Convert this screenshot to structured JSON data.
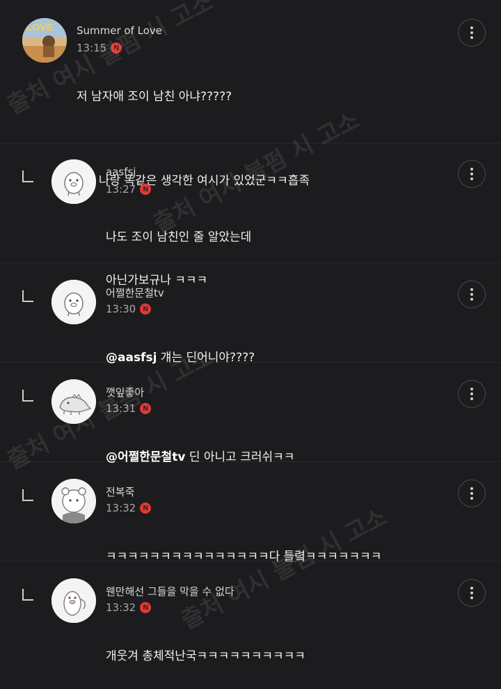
{
  "badge_letter": "N",
  "comments": [
    {
      "name": "Summer of Love",
      "time": "13:15",
      "lines": [
        "저 남자애 조이 남친 아냐?????",
        "",
        "아.. 나랑 똑같은 생각한 여시가 있었군ㅋㅋ흡족"
      ],
      "reply": false
    },
    {
      "name": "aasfsj",
      "time": "13:27",
      "lines": [
        "나도 조이 남친인 줄 알았는데",
        "아닌가보규나 ㅋㅋㅋ"
      ],
      "reply": true
    },
    {
      "name": "어쩔한문철tv",
      "time": "13:30",
      "mention": "@aasfsj",
      "text": " 걔는 딘어니야????",
      "reply": true
    },
    {
      "name": "깻잎좋아",
      "time": "13:31",
      "mention": "@어쩔한문철tv",
      "text": " 딘 아니고 크러쉬ㅋㅋ",
      "reply": true
    },
    {
      "name": "전복죽",
      "time": "13:32",
      "lines": [
        "ㅋㅋㅋㅋㅋㅋㅋㅋㅋㅋㅋㅋㅋㅋㅋ다 틀렼ㅋㅋㅋㅋㅋㅋㅋ"
      ],
      "reply": true
    },
    {
      "name": "웬만해선 그들을 막을 수 없다",
      "time": "13:32",
      "lines": [
        "개웃겨 총체적난국ㅋㅋㅋㅋㅋㅋㅋㅋㅋㅋ"
      ],
      "reply": true
    }
  ],
  "watermark": "출처 여시 불펌 시 고소",
  "colors": {
    "background": "#1c1c1e",
    "badge": "#e03a34",
    "divider": "#2a2a2c"
  },
  "icons": {
    "more": "more-vertical-icon",
    "reply": "reply-arrow-icon",
    "badge": "new-badge-icon"
  }
}
